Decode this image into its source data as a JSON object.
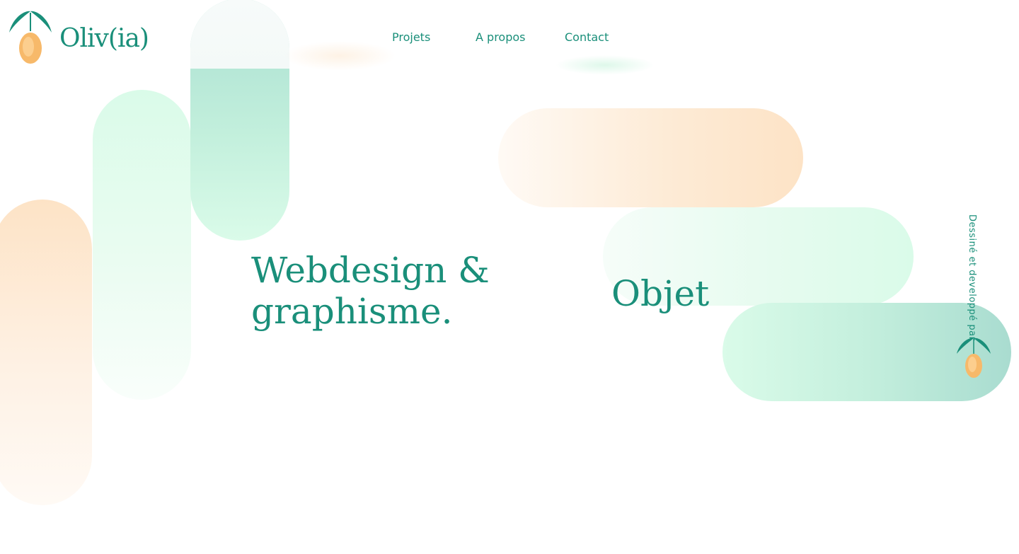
{
  "brand": {
    "name": "Oliv(ia)",
    "logo_icon": "olive-branch-icon"
  },
  "nav": {
    "items": [
      {
        "label": "Projets"
      },
      {
        "label": "A propos"
      },
      {
        "label": "Contact"
      }
    ]
  },
  "hero": {
    "headline_line1": "Webdesign &",
    "headline_line2": "graphisme.",
    "secondary_heading": "Objet"
  },
  "footer_credit": {
    "text": "Dessiné et developpé par",
    "icon": "olive-icon"
  },
  "colors": {
    "accent": "#1a8f7a",
    "mint": "#dafbe9",
    "teal": "#a9dcd0",
    "peach": "#fde3c6",
    "olive_fruit": "#f7b96a"
  }
}
